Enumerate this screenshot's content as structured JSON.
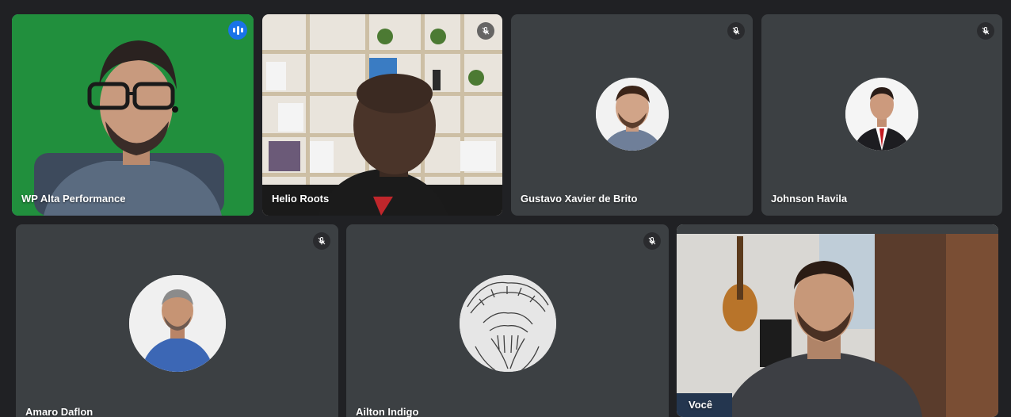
{
  "participants": [
    {
      "name": "WP Alta Performance",
      "state": "speaking",
      "icon": "audio-level-icon"
    },
    {
      "name": "Helio Roots",
      "state": "muted",
      "icon": "mic-off-icon"
    },
    {
      "name": "Gustavo Xavier de Brito",
      "state": "muted",
      "icon": "mic-off-icon"
    },
    {
      "name": "Johnson Havila",
      "state": "muted",
      "icon": "mic-off-icon"
    },
    {
      "name": "Amaro Daflon",
      "state": "muted",
      "icon": "mic-off-icon"
    },
    {
      "name": "Ailton Indigo",
      "state": "muted",
      "icon": "mic-off-icon"
    },
    {
      "name": "Você",
      "state": "self"
    }
  ],
  "colors": {
    "background": "#202124",
    "tile": "#3c4043",
    "speaking_outline": "#8ab4f8",
    "speaking_badge": "#1a73e8",
    "greenscreen": "#1f8a3a"
  }
}
